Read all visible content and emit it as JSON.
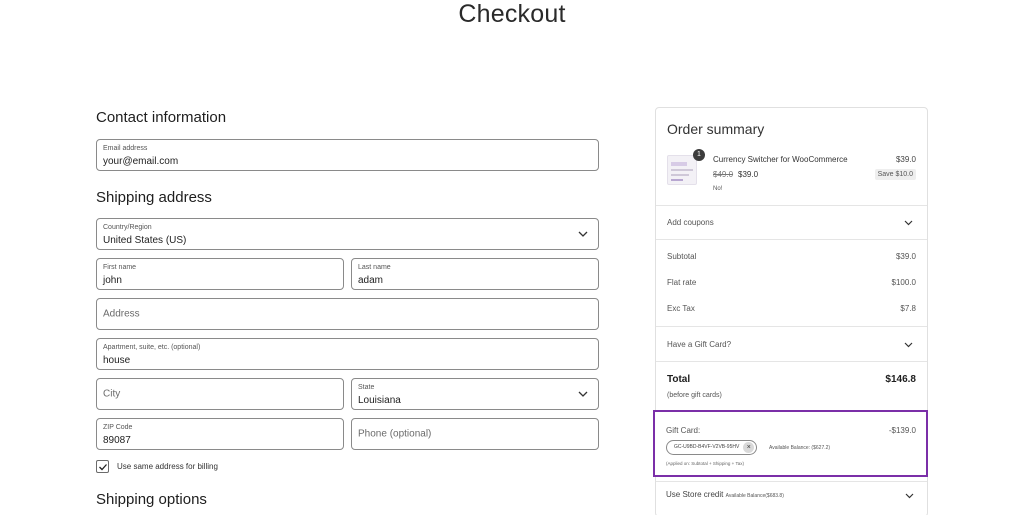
{
  "page": {
    "title": "Checkout"
  },
  "contact": {
    "heading": "Contact information",
    "email_label": "Email address",
    "email_value": "your@email.com"
  },
  "shipping": {
    "heading": "Shipping address",
    "country_label": "Country/Region",
    "country_value": "United States (US)",
    "first_name_label": "First name",
    "first_name_value": "john",
    "last_name_label": "Last name",
    "last_name_value": "adam",
    "address_placeholder": "Address",
    "apartment_label": "Apartment, suite, etc. (optional)",
    "apartment_value": "house",
    "city_placeholder": "City",
    "state_label": "State",
    "state_value": "Louisiana",
    "zip_label": "ZIP Code",
    "zip_value": "89087",
    "phone_placeholder": "Phone (optional)",
    "billing_checkbox_label": "Use same address for billing",
    "billing_checked": true
  },
  "shipping_options": {
    "heading": "Shipping options"
  },
  "summary": {
    "title": "Order summary",
    "item": {
      "quantity": "1",
      "name": "Currency Switcher for WooCommerce",
      "old_price": "$49.0",
      "new_price": "$39.0",
      "note": "No!",
      "line_price": "$39.0",
      "save_badge": "Save $10.0"
    },
    "add_coupons": "Add coupons",
    "subtotal_label": "Subtotal",
    "subtotal_value": "$39.0",
    "flat_rate_label": "Flat rate",
    "flat_rate_value": "$100.0",
    "tax_label": "Exc Tax",
    "tax_value": "$7.8",
    "gift_card_toggle": "Have a Gift Card?",
    "total_label": "Total",
    "total_sub": "(before gift cards)",
    "total_value": "$146.8",
    "gift_card": {
      "label": "Gift Card:",
      "value": "-$139.0",
      "code": "GC-U9BD-B4VF-V2VB-95HV",
      "remove_icon": "×",
      "balance": "Available Balance: ($627.2)",
      "applied_on": "(Applied on: Subtotal + Shipping + Tax)"
    },
    "store_credit_label": "Use Store credit",
    "store_credit_balance": "Available Balance($683.8)"
  },
  "colors": {
    "gift_card_highlight": "#7b2fa8",
    "border": "#8a8a8a"
  },
  "icons": {
    "dropdown": "chevron-down-icon",
    "checkbox": "checkmark-icon",
    "remove": "close-icon"
  }
}
